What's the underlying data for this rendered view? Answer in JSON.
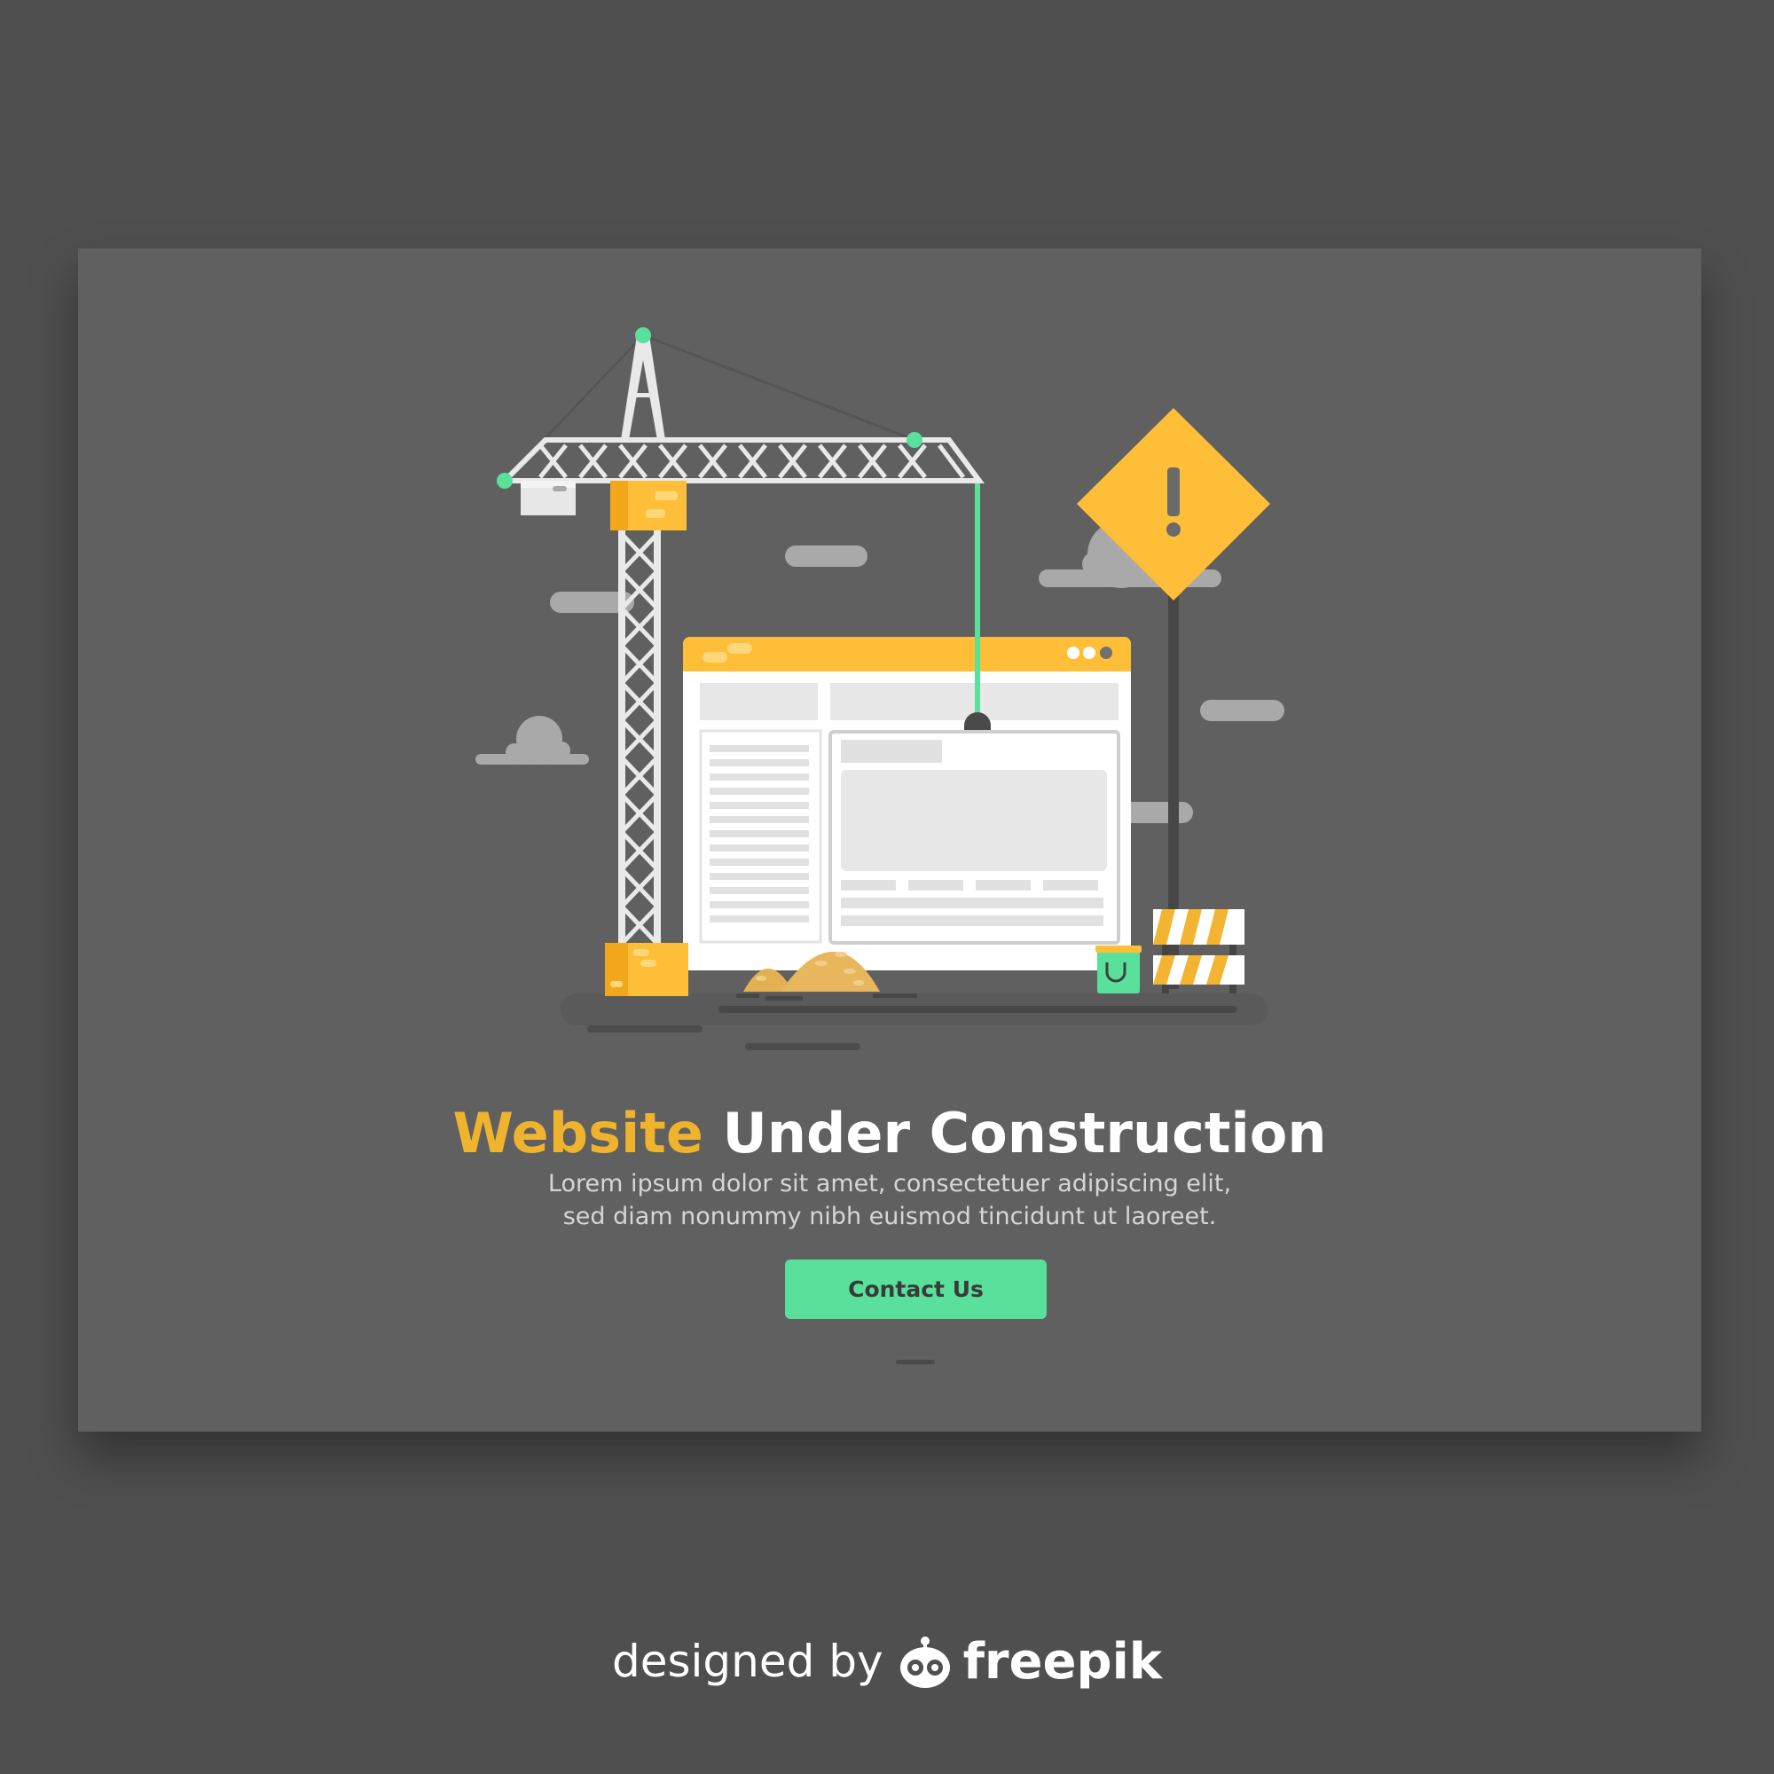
{
  "headline": {
    "accent": "Website",
    "rest": " Under Construction"
  },
  "subtext": {
    "line1": "Lorem ipsum dolor sit amet, consectetuer adipiscing elit,",
    "line2": "sed diam nonummy nibh euismod tincidunt ut laoreet."
  },
  "cta": {
    "label": "Contact Us"
  },
  "credit": {
    "prefix": "designed by",
    "brand": "freepik"
  },
  "warning_sign": {
    "symbol": "!"
  },
  "colors": {
    "page_background": "#4f4f4f",
    "card_background": "#606060",
    "accent_yellow": "#f0b32e",
    "sign_yellow": "#ffbe37",
    "accent_green": "#59e09b",
    "text_light": "#d6d6d6"
  },
  "icons": [
    "crane-icon",
    "warning-sign-icon",
    "browser-window-icon",
    "barricade-icon",
    "paint-bucket-icon",
    "sand-pile-icon",
    "cloud-icon",
    "freepik-logo-icon"
  ]
}
